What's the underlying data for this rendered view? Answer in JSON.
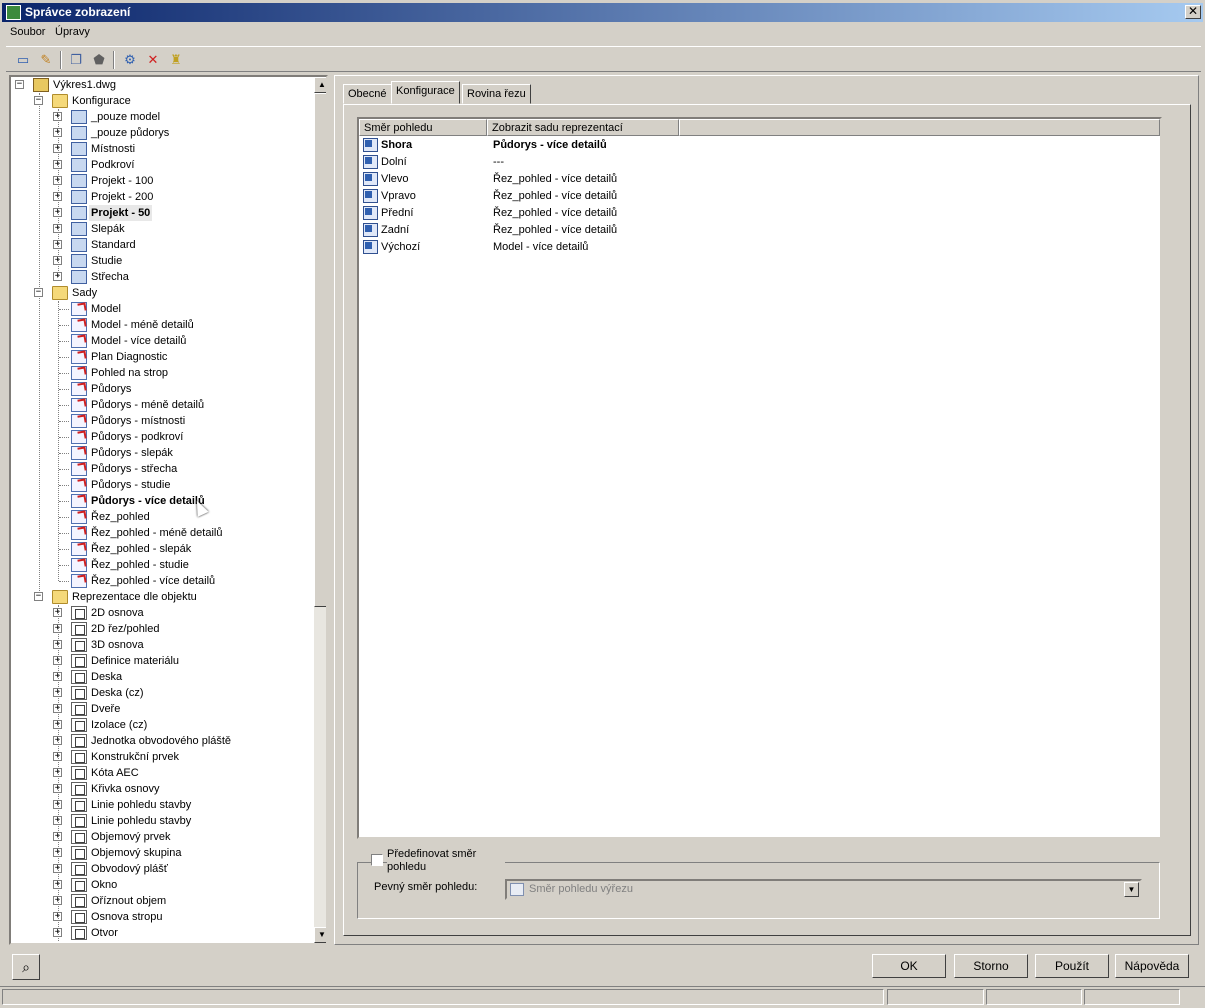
{
  "window": {
    "title": "Správce zobrazení",
    "close_label": "✕"
  },
  "menu": [
    "Soubor",
    "Úpravy"
  ],
  "toolbar": [
    {
      "name": "new-icon",
      "glyph": "▭"
    },
    {
      "name": "edit-icon",
      "glyph": "✎"
    },
    {
      "name": "copy-icon",
      "glyph": "❐"
    },
    {
      "name": "purge-icon",
      "glyph": "⬟"
    },
    {
      "name": "update-icon",
      "glyph": "⚙"
    },
    {
      "name": "delete-icon",
      "glyph": "✕"
    },
    {
      "name": "cleanup-icon",
      "glyph": "♜"
    }
  ],
  "tree": {
    "root": "Výkres1.dwg",
    "config_folder": "Konfigurace",
    "configs": [
      "_pouze model",
      "_pouze půdorys",
      "Místnosti",
      "Podkroví",
      "Projekt - 100",
      "Projekt - 200",
      "Projekt - 50",
      "Slepák",
      "Standard",
      "Studie",
      "Střecha"
    ],
    "sets_folder": "Sady",
    "sets": [
      "Model",
      "Model - méně detailů",
      "Model - více detailů",
      "Plan Diagnostic",
      "Pohled na strop",
      "Půdorys",
      "Půdorys - méně detailů",
      "Půdorys - místnosti",
      "Půdorys - podkroví",
      "Půdorys - slepák",
      "Půdorys - střecha",
      "Půdorys - studie",
      "Půdorys - více detailů",
      "Řez_pohled",
      "Řez_pohled - méně detailů",
      "Řez_pohled - slepák",
      "Řez_pohled - studie",
      "Řez_pohled - více detailů"
    ],
    "repr_folder": "Reprezentace dle objektu",
    "objects": [
      "2D osnova",
      "2D řez/pohled",
      "3D osnova",
      "Definice materiálu",
      "Deska",
      "Deska (cz)",
      "Dveře",
      "Izolace (cz)",
      "Jednotka obvodového pláště",
      "Konstrukční prvek",
      "Kóta AEC",
      "Křivka osnovy",
      "Linie pohledu stavby",
      "Linie pohledu stavby",
      "Objemový prvek",
      "Objemový skupina",
      "Obvodový plášť",
      "Okno",
      "Oříznout objem",
      "Osnova stropu",
      "Otvor"
    ]
  },
  "tabs": [
    "Obecné",
    "Konfigurace",
    "Rovina řezu"
  ],
  "table": {
    "headers": [
      "Směr pohledu",
      "Zobrazit sadu reprezentací"
    ],
    "rows": [
      {
        "dir": "Shora",
        "set": "Půdorys - více detailů",
        "bold": true
      },
      {
        "dir": "Dolní",
        "set": "---",
        "bold": false
      },
      {
        "dir": "Vlevo",
        "set": "Řez_pohled - více detailů",
        "bold": false
      },
      {
        "dir": "Vpravo",
        "set": "Řez_pohled - více detailů",
        "bold": false
      },
      {
        "dir": "Přední",
        "set": "Řez_pohled - více detailů",
        "bold": false
      },
      {
        "dir": "Zadní",
        "set": "Řez_pohled - více detailů",
        "bold": false
      },
      {
        "dir": "Výchozí",
        "set": "Model - více detailů",
        "bold": false
      }
    ]
  },
  "override": {
    "checkbox_label": "Předefinovat směr pohledu",
    "fixed_label": "Pevný směr pohledu:",
    "fixed_value": "Směr pohledu výřezu"
  },
  "buttons": {
    "ok": "OK",
    "cancel": "Storno",
    "apply": "Použít",
    "help": "Nápověda"
  }
}
